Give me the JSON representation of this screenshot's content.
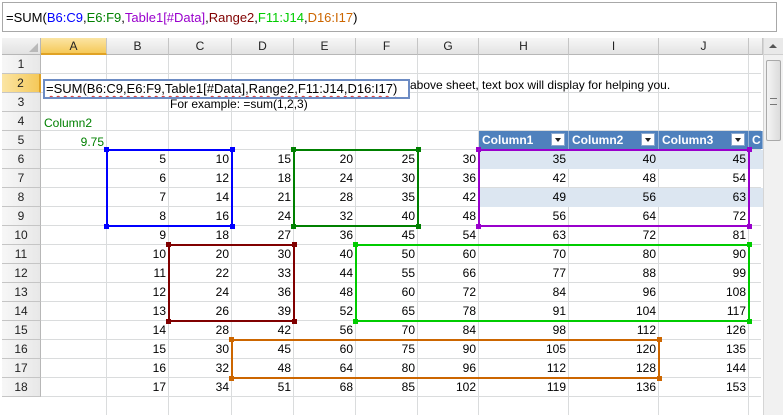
{
  "formula_bar": {
    "segments": [
      {
        "text": "=SUM(",
        "color": "#000000"
      },
      {
        "text": "B6:C9",
        "color": "#0000ff"
      },
      {
        "text": ",",
        "color": "#000000"
      },
      {
        "text": "E6:F9",
        "color": "#008000"
      },
      {
        "text": ",",
        "color": "#000000"
      },
      {
        "text": "Table1[#Data]",
        "color": "#9900cc"
      },
      {
        "text": ",",
        "color": "#000000"
      },
      {
        "text": "Range2",
        "color": "#800000"
      },
      {
        "text": ",",
        "color": "#000000"
      },
      {
        "text": "F11:J14",
        "color": "#00cc00"
      },
      {
        "text": ",",
        "color": "#000000"
      },
      {
        "text": "D16:I17",
        "color": "#cc6600"
      },
      {
        "text": ")",
        "color": "#000000"
      }
    ]
  },
  "cell_editor": {
    "text": "=SUM(B6:C9,E6:F9,Table1[#Data],Range2,F11:J14,D16:I17)"
  },
  "columns": [
    "A",
    "B",
    "C",
    "D",
    "E",
    "F",
    "G",
    "H",
    "I",
    "J"
  ],
  "selected_column": "A",
  "rows": [
    "1",
    "2",
    "3",
    "4",
    "5",
    "6",
    "7",
    "8",
    "9",
    "10",
    "11",
    "12",
    "13",
    "14",
    "15",
    "16",
    "17",
    "18"
  ],
  "selected_row": "2",
  "text_cells": {
    "hint_line": "above sheet, text box will display for helping you.",
    "example_line": "For example: =sum(1,2,3)",
    "name_label": "Column2",
    "name_value": "9.75"
  },
  "table1": {
    "headers": [
      "Column1",
      "Column2",
      "Column3",
      "C"
    ],
    "header_color": "#4f81bd",
    "band_color": "#dce6f1"
  },
  "grid_values": [
    {
      "row": 6,
      "vals": {
        "B": 5,
        "C": 10,
        "D": 15,
        "E": 20,
        "F": 25,
        "G": 30,
        "H": 35,
        "I": 40,
        "J": 45
      }
    },
    {
      "row": 7,
      "vals": {
        "B": 6,
        "C": 12,
        "D": 18,
        "E": 24,
        "F": 30,
        "G": 36,
        "H": 42,
        "I": 48,
        "J": 54
      }
    },
    {
      "row": 8,
      "vals": {
        "B": 7,
        "C": 14,
        "D": 21,
        "E": 28,
        "F": 35,
        "G": 42,
        "H": 49,
        "I": 56,
        "J": 63
      }
    },
    {
      "row": 9,
      "vals": {
        "B": 8,
        "C": 16,
        "D": 24,
        "E": 32,
        "F": 40,
        "G": 48,
        "H": 56,
        "I": 64,
        "J": 72
      }
    },
    {
      "row": 10,
      "vals": {
        "B": 9,
        "C": 18,
        "D": 27,
        "E": 36,
        "F": 45,
        "G": 54,
        "H": 63,
        "I": 72,
        "J": 81
      }
    },
    {
      "row": 11,
      "vals": {
        "B": 10,
        "C": 20,
        "D": 30,
        "E": 40,
        "F": 50,
        "G": 60,
        "H": 70,
        "I": 80,
        "J": 90
      }
    },
    {
      "row": 12,
      "vals": {
        "B": 11,
        "C": 22,
        "D": 33,
        "E": 44,
        "F": 55,
        "G": 66,
        "H": 77,
        "I": 88,
        "J": 99
      }
    },
    {
      "row": 13,
      "vals": {
        "B": 12,
        "C": 24,
        "D": 36,
        "E": 48,
        "F": 60,
        "G": 72,
        "H": 84,
        "I": 96,
        "J": 108
      }
    },
    {
      "row": 14,
      "vals": {
        "B": 13,
        "C": 26,
        "D": 39,
        "E": 52,
        "F": 65,
        "G": 78,
        "H": 91,
        "I": 104,
        "J": 117
      }
    },
    {
      "row": 15,
      "vals": {
        "B": 14,
        "C": 28,
        "D": 42,
        "E": 56,
        "F": 70,
        "G": 84,
        "H": 98,
        "I": 112,
        "J": 126
      }
    },
    {
      "row": 16,
      "vals": {
        "B": 15,
        "C": 30,
        "D": 45,
        "E": 60,
        "F": 75,
        "G": 90,
        "H": 105,
        "I": 120,
        "J": 135
      }
    },
    {
      "row": 17,
      "vals": {
        "B": 16,
        "C": 32,
        "D": 48,
        "E": 64,
        "F": 80,
        "G": 96,
        "H": 112,
        "I": 128,
        "J": 144
      }
    },
    {
      "row": 18,
      "vals": {
        "B": 17,
        "C": 34,
        "D": 51,
        "E": 68,
        "F": 85,
        "G": 102,
        "H": 119,
        "I": 136,
        "J": 153
      }
    }
  ],
  "range_highlights": [
    {
      "name": "range-b6-c9",
      "ref": "B6:C9",
      "color": "#0000ff"
    },
    {
      "name": "range-e6-f9",
      "ref": "E6:F9",
      "color": "#008000"
    },
    {
      "name": "range-table1-data",
      "ref": "Table1[#Data]",
      "color": "#9900cc"
    },
    {
      "name": "range-range2",
      "ref": "Range2",
      "color": "#800000"
    },
    {
      "name": "range-f11-j14",
      "ref": "F11:J14",
      "color": "#00cc00"
    },
    {
      "name": "range-d16-i17",
      "ref": "D16:I17",
      "color": "#cc6600"
    }
  ]
}
